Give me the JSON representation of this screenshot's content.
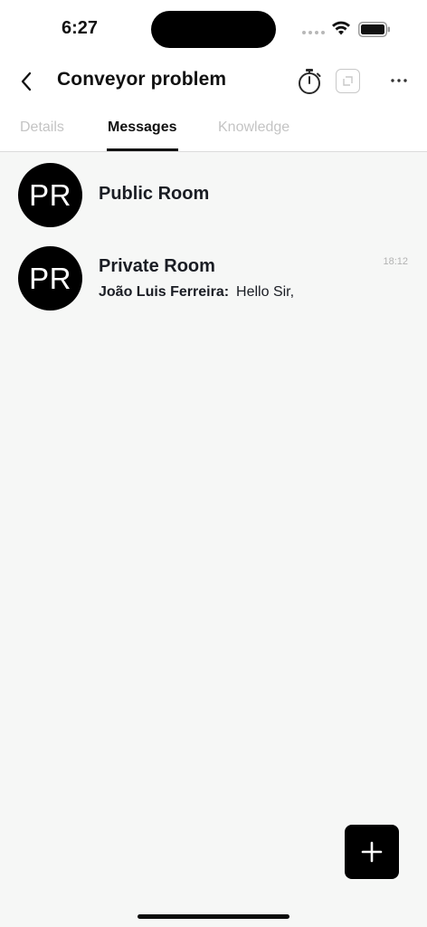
{
  "status_bar": {
    "time": "6:27",
    "icons": [
      "cellular-signal-icon",
      "wifi-icon",
      "battery-icon"
    ]
  },
  "header": {
    "title": "Conveyor problem",
    "back_icon": "chevron-left-icon",
    "timer_icon": "stopwatch-icon",
    "copy_icon": "copy-icon",
    "more_icon": "more-horizontal-icon"
  },
  "tabs": [
    {
      "label": "Details",
      "active": false
    },
    {
      "label": "Messages",
      "active": true
    },
    {
      "label": "Knowledge",
      "active": false
    }
  ],
  "rooms": [
    {
      "initials": "PR",
      "name": "Public Room",
      "time": "",
      "sender": "",
      "message": ""
    },
    {
      "initials": "PR",
      "name": "Private Room",
      "time": "18:12",
      "sender": "João Luis Ferreira:",
      "message": "Hello Sir,"
    }
  ],
  "fab": {
    "icon": "plus-icon"
  },
  "colors": {
    "background": "#f6f7f6",
    "header_background": "#ffffff",
    "avatar": "#000000",
    "text_primary": "#1a1d24",
    "tab_inactive": "#c4c4c4",
    "fab": "#000000"
  }
}
